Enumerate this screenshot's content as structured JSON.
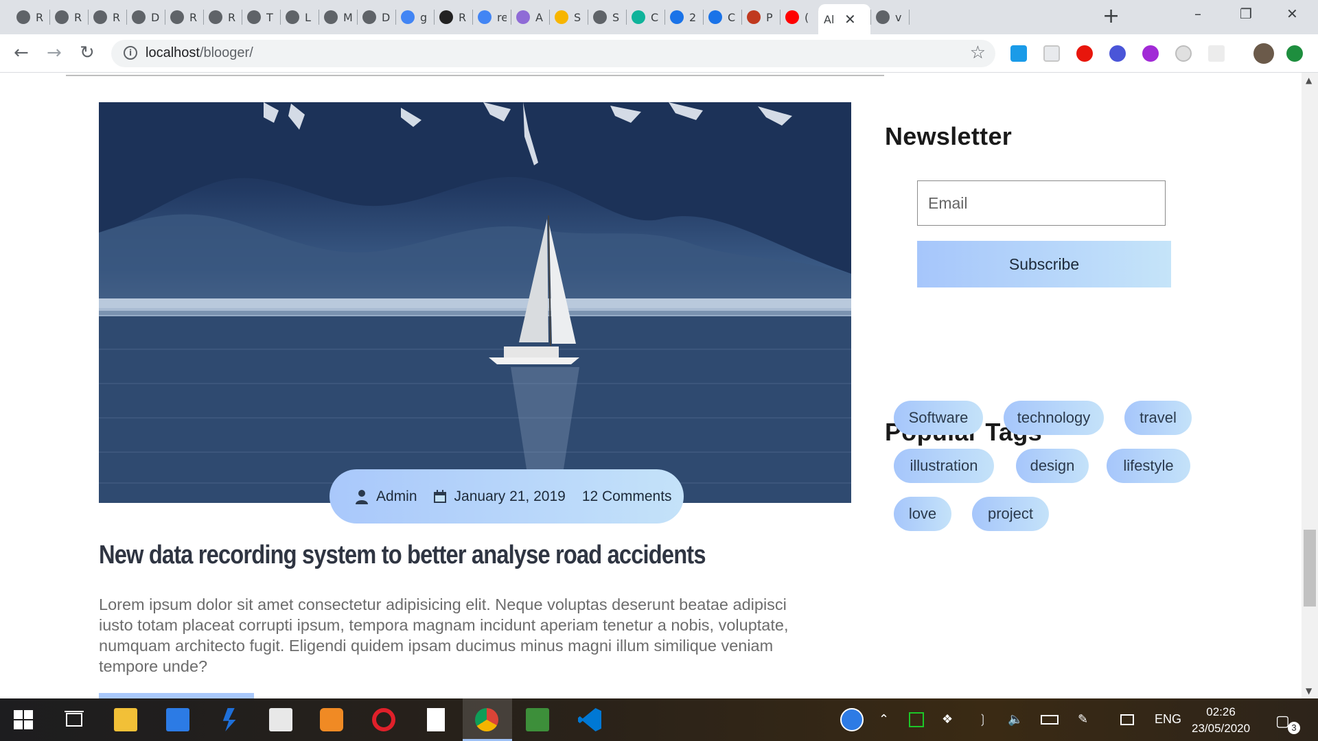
{
  "browser": {
    "tabs": [
      {
        "label": "R",
        "icon": "globe-icon"
      },
      {
        "label": "R",
        "icon": "globe-icon"
      },
      {
        "label": "R",
        "icon": "globe-icon"
      },
      {
        "label": "D",
        "icon": "globe-icon"
      },
      {
        "label": "R",
        "icon": "globe-icon"
      },
      {
        "label": "R",
        "icon": "globe-icon"
      },
      {
        "label": "T",
        "icon": "globe-icon"
      },
      {
        "label": "L",
        "icon": "globe-icon"
      },
      {
        "label": "M",
        "icon": "globe-icon"
      },
      {
        "label": "D",
        "icon": "globe-icon"
      },
      {
        "label": "g",
        "icon": "google-icon"
      },
      {
        "label": "R",
        "icon": "codepen-icon"
      },
      {
        "label": "re",
        "icon": "google-icon"
      },
      {
        "label": "A",
        "icon": "dribbble-icon"
      },
      {
        "label": "S",
        "icon": "sketch-icon"
      },
      {
        "label": "S",
        "icon": "globe-icon"
      },
      {
        "label": "C",
        "icon": "diamond-icon"
      },
      {
        "label": "2",
        "icon": "flag-icon"
      },
      {
        "label": "C",
        "icon": "flag-icon"
      },
      {
        "label": "P",
        "icon": "angular-icon"
      },
      {
        "label": "(",
        "icon": "youtube-icon"
      },
      {
        "label": "Al",
        "icon": "none",
        "active": true
      },
      {
        "label": "v",
        "icon": "globe-icon"
      }
    ],
    "url_host": "localhost",
    "url_path": "/blooger/"
  },
  "post": {
    "author": "Admin",
    "date": "January 21, 2019",
    "comments": "12 Comments",
    "title": "New data recording system to better analyse road accidents",
    "excerpt": "Lorem ipsum dolor sit amet consectetur adipisicing elit. Neque voluptas deserunt beatae adipisci iusto totam placeat corrupti ipsum, tempora magnam incidunt aperiam tenetur a nobis, voluptate, numquam architecto fugit. Eligendi quidem ipsam ducimus minus magni illum similique veniam tempore unde?"
  },
  "sidebar": {
    "newsletter_heading": "Newsletter",
    "email_placeholder": "Email",
    "subscribe_label": "Subscribe",
    "tags_heading": "Popular Tags",
    "tags": [
      "Software",
      "technology",
      "travel",
      "illustration",
      "design",
      "lifestyle",
      "love",
      "project"
    ]
  },
  "taskbar": {
    "language": "ENG",
    "time": "02:26",
    "date": "23/05/2020",
    "notification_count": "3"
  },
  "colors": {
    "accent_gradient_start": "#a9c8fb",
    "accent_gradient_end": "#c4e2f9",
    "title_text": "#2f3542",
    "body_text": "#6c6c6c"
  }
}
